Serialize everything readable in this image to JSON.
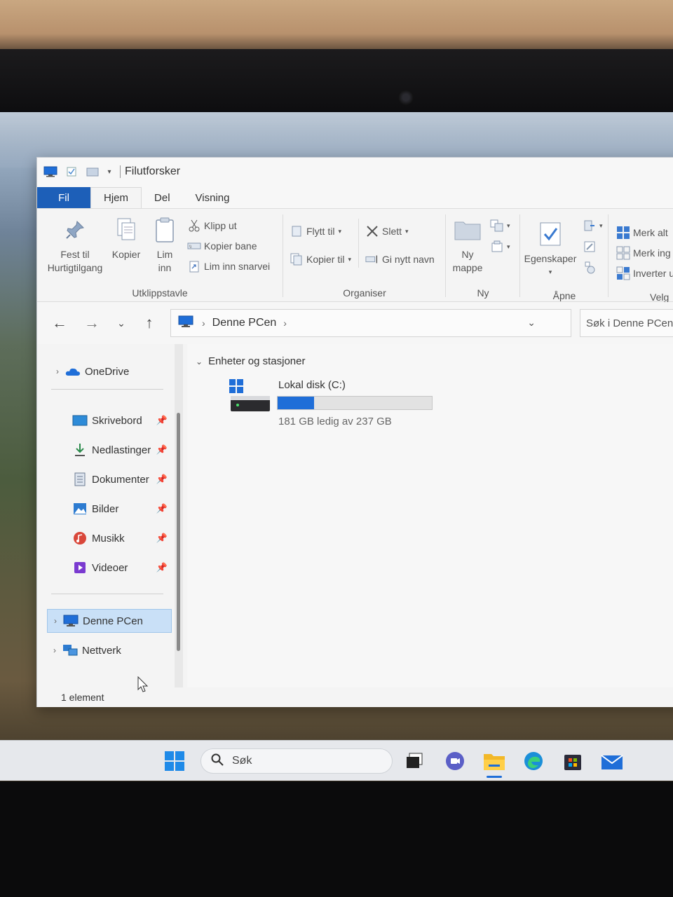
{
  "window": {
    "title": "Filutforsker",
    "tabs": [
      {
        "label": "Fil"
      },
      {
        "label": "Hjem"
      },
      {
        "label": "Del"
      },
      {
        "label": "Visning"
      }
    ]
  },
  "ribbon": {
    "clipboard": {
      "pin_line1": "Fest til",
      "pin_line2": "Hurtigtilgang",
      "copy": "Kopier",
      "paste_line1": "Lim",
      "paste_line2": "inn",
      "cut": "Klipp ut",
      "copy_path": "Kopier bane",
      "paste_shortcut": "Lim inn snarvei",
      "label": "Utklippstavle"
    },
    "organize": {
      "move_to": "Flytt til",
      "copy_to": "Kopier til",
      "delete": "Slett",
      "rename": "Gi nytt navn",
      "label": "Organiser"
    },
    "new": {
      "new_folder_line1": "Ny",
      "new_folder_line2": "mappe",
      "label": "Ny"
    },
    "open": {
      "properties": "Egenskaper",
      "label": "Åpne"
    },
    "select": {
      "select_all": "Merk alt",
      "select_none": "Merk ing",
      "invert": "Inverter u",
      "label": "Velg"
    }
  },
  "address": {
    "crumb": "Denne PCen",
    "search_placeholder": "Søk i Denne PCen"
  },
  "nav": {
    "onedrive": "OneDrive",
    "quick": [
      {
        "label": "Skrivebord"
      },
      {
        "label": "Nedlastinger"
      },
      {
        "label": "Dokumenter"
      },
      {
        "label": "Bilder"
      },
      {
        "label": "Musikk"
      },
      {
        "label": "Videoer"
      }
    ],
    "this_pc": "Denne PCen",
    "network": "Nettverk"
  },
  "content": {
    "section": "Enheter og stasjoner",
    "drive": {
      "name": "Lokal disk (C:)",
      "free_text": "181 GB ledig av 237 GB",
      "used_fraction": 0.236
    }
  },
  "status": {
    "count": "1 element"
  },
  "taskbar": {
    "search_label": "Søk"
  },
  "colors": {
    "accent": "#1f6ed8",
    "fil_tab": "#1d5fb8",
    "selection": "#c9e0f7"
  }
}
